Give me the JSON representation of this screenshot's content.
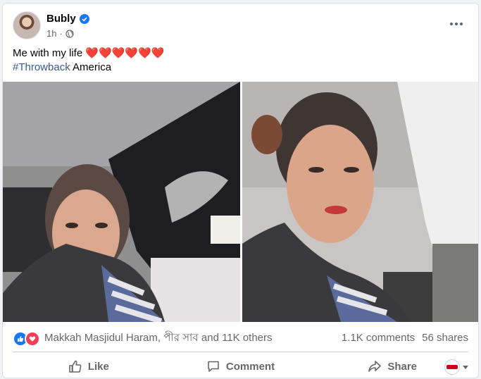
{
  "post": {
    "author": "Bubly",
    "time": "1h",
    "privacy_icon": "globe-icon",
    "caption_line1": "Me with my life",
    "caption_hearts": "❤️❤️❤️❤️❤️❤️",
    "hashtag": "#Throwback",
    "caption_line2_rest": " America"
  },
  "stats": {
    "reaction_icons": [
      "like-icon",
      "love-icon"
    ],
    "reaction_names": "Makkah Masjidul Haram, পীর সাব and 11K others",
    "comments": "1.1K comments",
    "shares": "56 shares"
  },
  "actions": {
    "like": "Like",
    "comment": "Comment",
    "share": "Share"
  },
  "colors": {
    "brand_blue": "#1877f2",
    "love_red": "#f33e58",
    "hashtag_blue": "#385898",
    "muted_text": "#65676b"
  }
}
